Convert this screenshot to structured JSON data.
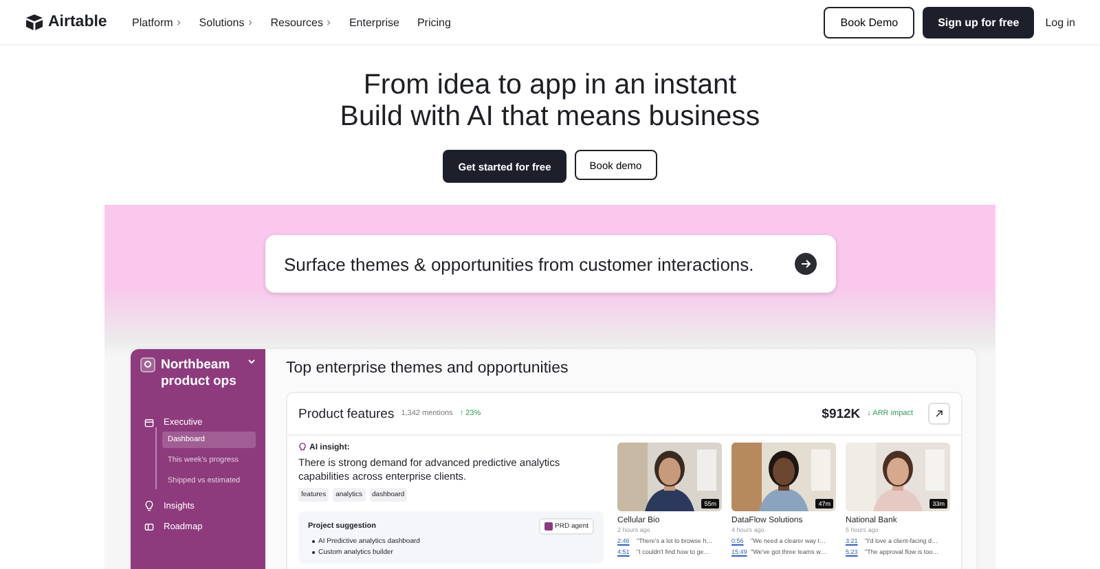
{
  "header": {
    "logo": "Airtable",
    "nav": [
      {
        "label": "Platform",
        "has_menu": true
      },
      {
        "label": "Solutions",
        "has_menu": true
      },
      {
        "label": "Resources",
        "has_menu": true
      },
      {
        "label": "Enterprise",
        "has_menu": false
      },
      {
        "label": "Pricing",
        "has_menu": false
      }
    ],
    "book_demo": "Book Demo",
    "sign_up": "Sign up for free",
    "log_in": "Log in"
  },
  "hero": {
    "title_lines": [
      "From idea to app in an instant",
      "Build with AI that means business"
    ],
    "primary": "Get started for free",
    "secondary": "Book demo"
  },
  "prompt": {
    "text": "Surface themes & opportunities from customer interactions."
  },
  "app": {
    "workspace": "Northbeam product ops",
    "sidebar": [
      {
        "label": "Executive",
        "children": [
          {
            "label": "Dashboard",
            "selected": true
          },
          {
            "label": "This week's progress",
            "selected": false
          },
          {
            "label": "Shipped vs estimated",
            "selected": false
          }
        ]
      },
      {
        "label": "Insights"
      },
      {
        "label": "Roadmap"
      }
    ],
    "page_title": "Top enterprise themes and opportunities",
    "card": {
      "title": "Product features",
      "mentions": "1,342 mentions",
      "trend": "↑ 23%",
      "amount": "$912K",
      "impact": "↓ ARR impact",
      "insight_label": "AI insight:",
      "insight": "There is strong demand for advanced predictive analytics capabilities across enterprise clients.",
      "tags": [
        "features",
        "analytics",
        "dashboard"
      ],
      "suggestion_title": "Project suggestion",
      "agent": "PRD agent",
      "suggestions": [
        "AI Predictive analytics dashboard",
        "Custom analytics builder"
      ],
      "calls": [
        {
          "kind": "picture",
          "duration": "55m",
          "company": "Cellular Bio",
          "ago": "2 hours ago",
          "quotes": [
            {
              "time": "2:46",
              "text": "\"There's a lot to browse h…"
            },
            {
              "time": "4:51",
              "text": "\"I couldn't find how to ge…"
            }
          ]
        },
        {
          "kind": "picture",
          "duration": "47m",
          "company": "DataFlow Solutions",
          "ago": "4 hours ago",
          "quotes": [
            {
              "time": "0:56",
              "text": "\"We need a clearer way t…"
            },
            {
              "time": "15:49",
              "text": "\"We've got three teams w…"
            }
          ]
        },
        {
          "kind": "picture",
          "duration": "33m",
          "company": "National Bank",
          "ago": "5 hours ago",
          "quotes": [
            {
              "time": "3:21",
              "text": "\"I'd love a client-facing d…"
            },
            {
              "time": "5:23",
              "text": "\"The approval flow is too…"
            }
          ]
        }
      ]
    }
  }
}
